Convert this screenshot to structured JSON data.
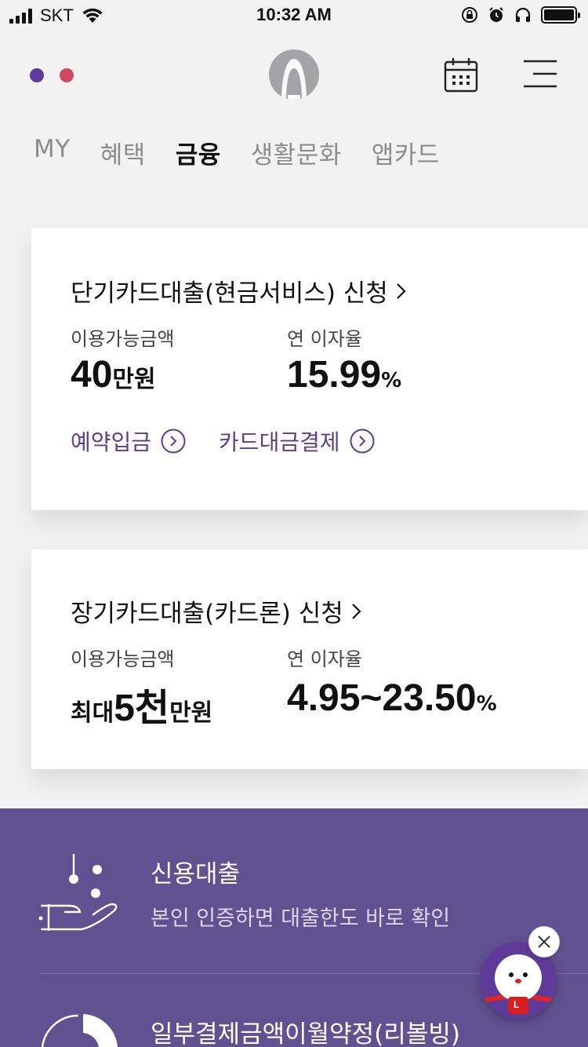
{
  "status_bar": {
    "carrier": "SKT",
    "time": "10:32 AM"
  },
  "header": {
    "dot_colors": [
      "#5e3a99",
      "#d04a62"
    ]
  },
  "tabs": [
    {
      "label": "MY",
      "active": false
    },
    {
      "label": "혜택",
      "active": false
    },
    {
      "label": "금융",
      "active": true
    },
    {
      "label": "생활문화",
      "active": false
    },
    {
      "label": "앱카드",
      "active": false
    }
  ],
  "card_short": {
    "title": "단기카드대출(현금서비스) 신청",
    "available_label": "이용가능금액",
    "available_value": "40",
    "available_unit": "만원",
    "rate_label": "연 이자율",
    "rate_value": "15.99",
    "rate_unit": "%",
    "links": [
      "예약입금",
      "카드대금결제"
    ]
  },
  "card_long": {
    "title": "장기카드대출(카드론) 신청",
    "available_label": "이용가능금액",
    "available_prefix": "최대",
    "available_value": "5천",
    "available_unit": "만원",
    "rate_label": "연 이자율",
    "rate_value": "4.95~23.50",
    "rate_unit": "%"
  },
  "promo": {
    "items": [
      {
        "title": "신용대출",
        "subtitle": "본인 인증하면 대출한도 바로 확인",
        "icon": "hand-coins-icon"
      },
      {
        "title": "일부결제금액이월약정(리볼빙)",
        "icon": "pie-chart-icon"
      }
    ]
  },
  "chatbot": {
    "badge": "L"
  },
  "colors": {
    "accent": "#5c3e91",
    "promo_bg": "#605190",
    "page_bg": "#f2f2f3"
  }
}
